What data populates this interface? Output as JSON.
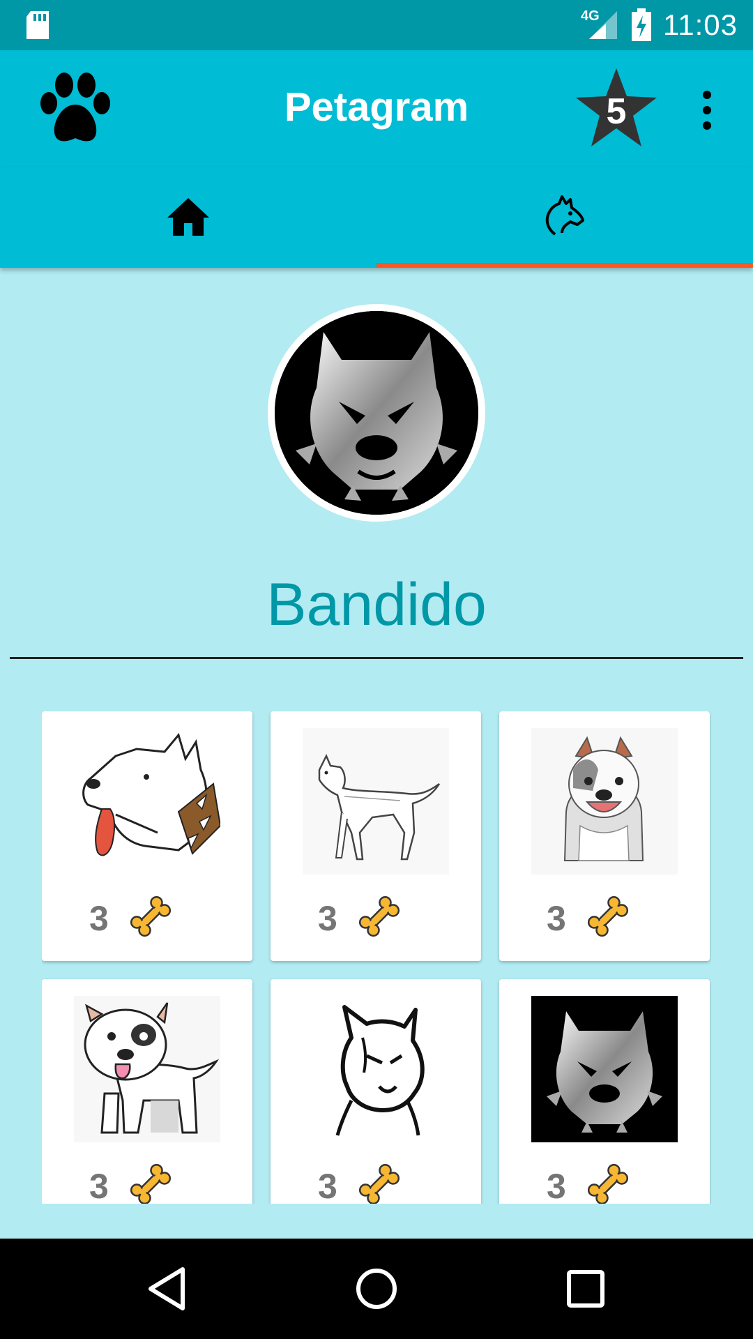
{
  "status_bar": {
    "time": "11:03",
    "network": "4G",
    "icons": [
      "sd-card-icon",
      "signal-icon",
      "battery-charging-icon"
    ]
  },
  "app_bar": {
    "title": "Petagram",
    "left_icon": "paw-icon",
    "rating_badge": "5",
    "rating_icon": "star-icon",
    "menu_icon": "more-vert-icon"
  },
  "tabs": [
    {
      "name": "home",
      "icon": "home-icon",
      "selected": false
    },
    {
      "name": "profile",
      "icon": "dog-icon",
      "selected": true
    }
  ],
  "accent_colors": {
    "primary": "#00bcd4",
    "primary_dark": "#0097a7",
    "indicator": "#ff5722",
    "background": "#b2ebf2"
  },
  "profile": {
    "name": "Bandido",
    "avatar": "pitbull-avatar"
  },
  "photos": [
    {
      "image": "pitbull-head-spiked-collar",
      "likes": "3",
      "like_icon": "bone-icon"
    },
    {
      "image": "pitbull-standing-sketch",
      "likes": "3",
      "like_icon": "bone-icon"
    },
    {
      "image": "cartoon-pitbull-bust",
      "likes": "3",
      "like_icon": "bone-icon"
    },
    {
      "image": "cartoon-pitbull-standing",
      "likes": "3",
      "like_icon": "bone-icon"
    },
    {
      "image": "tribal-pitbull-head",
      "likes": "3",
      "like_icon": "bone-icon"
    },
    {
      "image": "pitbull-avatar",
      "likes": "3",
      "like_icon": "bone-icon"
    }
  ],
  "nav_bar": {
    "buttons": [
      "back-icon",
      "home-circle-icon",
      "recents-icon"
    ]
  }
}
